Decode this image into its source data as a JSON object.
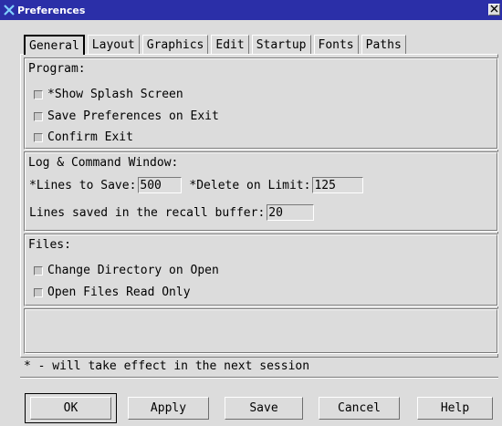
{
  "window": {
    "title": "Preferences"
  },
  "tabs": [
    "General",
    "Layout",
    "Graphics",
    "Edit",
    "Startup",
    "Fonts",
    "Paths"
  ],
  "program": {
    "label": "Program:",
    "options": [
      "*Show Splash Screen",
      "Save Preferences on Exit",
      "Confirm Exit"
    ]
  },
  "log": {
    "label": "Log & Command Window:",
    "lines_to_save_label": "*Lines to Save:",
    "lines_to_save_value": "500",
    "delete_on_limit_label": "*Delete on Limit:",
    "delete_on_limit_value": "125",
    "recall_label": "Lines saved in the recall buffer:",
    "recall_value": "20"
  },
  "files": {
    "label": "Files:",
    "options": [
      "Change Directory on Open",
      "Open Files Read Only"
    ]
  },
  "note": "* - will take effect in the next session",
  "buttons": {
    "ok": "OK",
    "apply": "Apply",
    "save": "Save",
    "cancel": "Cancel",
    "help": "Help"
  },
  "colors": {
    "titlebar": "#2b2fa8",
    "background": "#dcdcdc"
  },
  "icons": {
    "app": "x-logo-icon",
    "close": "close-icon"
  }
}
